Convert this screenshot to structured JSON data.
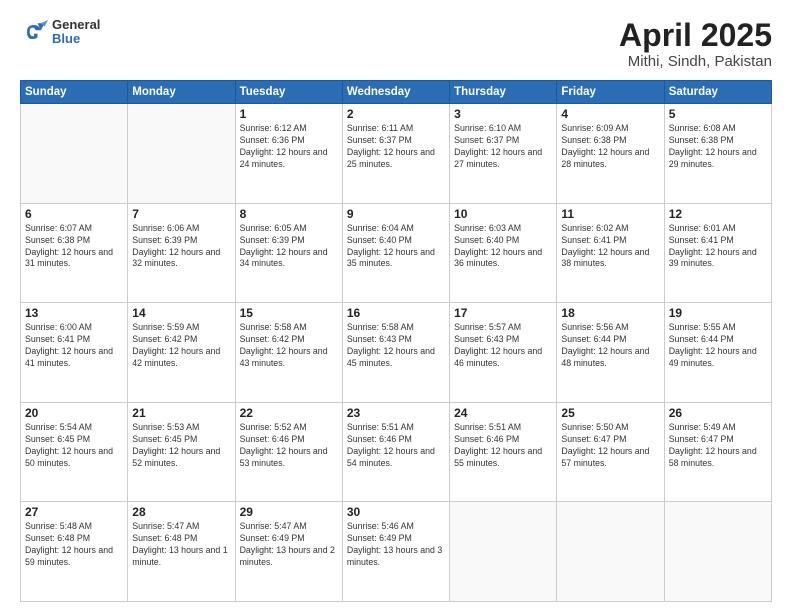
{
  "header": {
    "logo_general": "General",
    "logo_blue": "Blue",
    "title": "April 2025",
    "subtitle": "Mithi, Sindh, Pakistan"
  },
  "weekdays": [
    "Sunday",
    "Monday",
    "Tuesday",
    "Wednesday",
    "Thursday",
    "Friday",
    "Saturday"
  ],
  "weeks": [
    [
      {
        "day": null
      },
      {
        "day": null
      },
      {
        "day": "1",
        "sunrise": "6:12 AM",
        "sunset": "6:36 PM",
        "daylight": "12 hours and 24 minutes."
      },
      {
        "day": "2",
        "sunrise": "6:11 AM",
        "sunset": "6:37 PM",
        "daylight": "12 hours and 25 minutes."
      },
      {
        "day": "3",
        "sunrise": "6:10 AM",
        "sunset": "6:37 PM",
        "daylight": "12 hours and 27 minutes."
      },
      {
        "day": "4",
        "sunrise": "6:09 AM",
        "sunset": "6:38 PM",
        "daylight": "12 hours and 28 minutes."
      },
      {
        "day": "5",
        "sunrise": "6:08 AM",
        "sunset": "6:38 PM",
        "daylight": "12 hours and 29 minutes."
      }
    ],
    [
      {
        "day": "6",
        "sunrise": "6:07 AM",
        "sunset": "6:38 PM",
        "daylight": "12 hours and 31 minutes."
      },
      {
        "day": "7",
        "sunrise": "6:06 AM",
        "sunset": "6:39 PM",
        "daylight": "12 hours and 32 minutes."
      },
      {
        "day": "8",
        "sunrise": "6:05 AM",
        "sunset": "6:39 PM",
        "daylight": "12 hours and 34 minutes."
      },
      {
        "day": "9",
        "sunrise": "6:04 AM",
        "sunset": "6:40 PM",
        "daylight": "12 hours and 35 minutes."
      },
      {
        "day": "10",
        "sunrise": "6:03 AM",
        "sunset": "6:40 PM",
        "daylight": "12 hours and 36 minutes."
      },
      {
        "day": "11",
        "sunrise": "6:02 AM",
        "sunset": "6:41 PM",
        "daylight": "12 hours and 38 minutes."
      },
      {
        "day": "12",
        "sunrise": "6:01 AM",
        "sunset": "6:41 PM",
        "daylight": "12 hours and 39 minutes."
      }
    ],
    [
      {
        "day": "13",
        "sunrise": "6:00 AM",
        "sunset": "6:41 PM",
        "daylight": "12 hours and 41 minutes."
      },
      {
        "day": "14",
        "sunrise": "5:59 AM",
        "sunset": "6:42 PM",
        "daylight": "12 hours and 42 minutes."
      },
      {
        "day": "15",
        "sunrise": "5:58 AM",
        "sunset": "6:42 PM",
        "daylight": "12 hours and 43 minutes."
      },
      {
        "day": "16",
        "sunrise": "5:58 AM",
        "sunset": "6:43 PM",
        "daylight": "12 hours and 45 minutes."
      },
      {
        "day": "17",
        "sunrise": "5:57 AM",
        "sunset": "6:43 PM",
        "daylight": "12 hours and 46 minutes."
      },
      {
        "day": "18",
        "sunrise": "5:56 AM",
        "sunset": "6:44 PM",
        "daylight": "12 hours and 48 minutes."
      },
      {
        "day": "19",
        "sunrise": "5:55 AM",
        "sunset": "6:44 PM",
        "daylight": "12 hours and 49 minutes."
      }
    ],
    [
      {
        "day": "20",
        "sunrise": "5:54 AM",
        "sunset": "6:45 PM",
        "daylight": "12 hours and 50 minutes."
      },
      {
        "day": "21",
        "sunrise": "5:53 AM",
        "sunset": "6:45 PM",
        "daylight": "12 hours and 52 minutes."
      },
      {
        "day": "22",
        "sunrise": "5:52 AM",
        "sunset": "6:46 PM",
        "daylight": "12 hours and 53 minutes."
      },
      {
        "day": "23",
        "sunrise": "5:51 AM",
        "sunset": "6:46 PM",
        "daylight": "12 hours and 54 minutes."
      },
      {
        "day": "24",
        "sunrise": "5:51 AM",
        "sunset": "6:46 PM",
        "daylight": "12 hours and 55 minutes."
      },
      {
        "day": "25",
        "sunrise": "5:50 AM",
        "sunset": "6:47 PM",
        "daylight": "12 hours and 57 minutes."
      },
      {
        "day": "26",
        "sunrise": "5:49 AM",
        "sunset": "6:47 PM",
        "daylight": "12 hours and 58 minutes."
      }
    ],
    [
      {
        "day": "27",
        "sunrise": "5:48 AM",
        "sunset": "6:48 PM",
        "daylight": "12 hours and 59 minutes."
      },
      {
        "day": "28",
        "sunrise": "5:47 AM",
        "sunset": "6:48 PM",
        "daylight": "13 hours and 1 minute."
      },
      {
        "day": "29",
        "sunrise": "5:47 AM",
        "sunset": "6:49 PM",
        "daylight": "13 hours and 2 minutes."
      },
      {
        "day": "30",
        "sunrise": "5:46 AM",
        "sunset": "6:49 PM",
        "daylight": "13 hours and 3 minutes."
      },
      {
        "day": null
      },
      {
        "day": null
      },
      {
        "day": null
      }
    ]
  ]
}
